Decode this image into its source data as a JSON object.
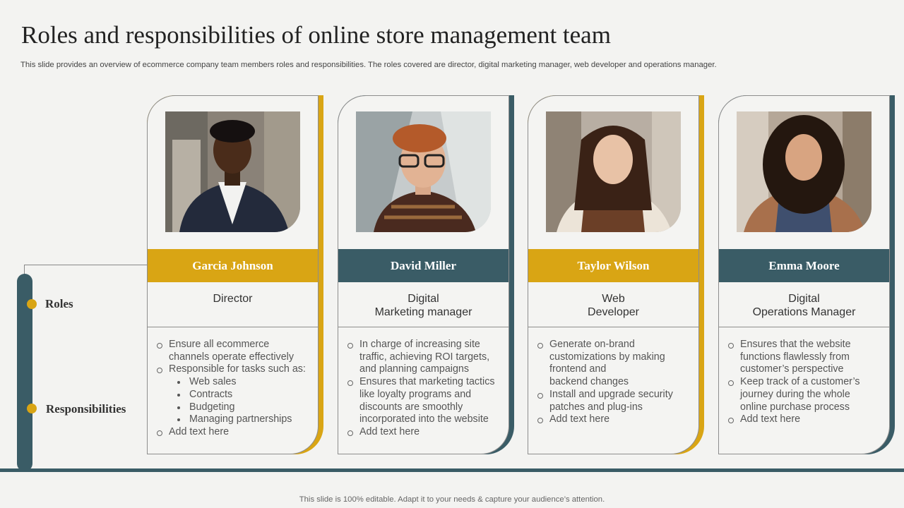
{
  "title": "Roles and responsibilities of online store management team",
  "subtitle": "This slide provides an overview of ecommerce company team members roles and responsibilities. The roles covered are director, digital marketing manager, web developer and operations manager.",
  "rail": {
    "roles_label": "Roles",
    "responsibilities_label": "Responsibilities"
  },
  "colors": {
    "gold": "#d9a514",
    "teal": "#3a5c66"
  },
  "cards": [
    {
      "name": "Garcia Johnson",
      "role": "Director",
      "accent": "gold",
      "photo": "portrait-man-suit",
      "responsibilities": [
        {
          "text": "Ensure all ecommerce",
          "level": 1
        },
        {
          "text": "channels operate effectively",
          "level": 0
        },
        {
          "text": "Responsible for tasks such as:",
          "level": 1
        },
        {
          "text": "Web sales",
          "level": 2
        },
        {
          "text": "Contracts",
          "level": 2
        },
        {
          "text": "Budgeting",
          "level": 2
        },
        {
          "text": "Managing partnerships",
          "level": 2
        },
        {
          "text": "Add text here",
          "level": 1
        }
      ]
    },
    {
      "name": "David Miller",
      "role": "Digital\nMarketing manager",
      "accent": "teal",
      "photo": "portrait-young-man-glasses",
      "responsibilities": [
        {
          "text": "In charge of increasing site",
          "level": 1
        },
        {
          "text": "traffic, achieving ROI targets,",
          "level": 0
        },
        {
          "text": "and planning campaigns",
          "level": 0
        },
        {
          "text": "Ensures that marketing tactics",
          "level": 1
        },
        {
          "text": "like loyalty programs and",
          "level": 0
        },
        {
          "text": "discounts are smoothly",
          "level": 0
        },
        {
          "text": "incorporated into the website",
          "level": 0
        },
        {
          "text": "Add text here",
          "level": 1
        }
      ]
    },
    {
      "name": "Taylor Wilson",
      "role": "Web\nDeveloper",
      "accent": "gold",
      "photo": "portrait-woman-scarf",
      "responsibilities": [
        {
          "text": "Generate on-brand",
          "level": 1
        },
        {
          "text": "customizations by making",
          "level": 0
        },
        {
          "text": "frontend and",
          "level": 0
        },
        {
          "text": "backend changes",
          "level": 0
        },
        {
          "text": "Install and upgrade security",
          "level": 1
        },
        {
          "text": "patches and plug-ins",
          "level": 0
        },
        {
          "text": "Add text here",
          "level": 1
        }
      ]
    },
    {
      "name": "Emma Moore",
      "role": "Digital\nOperations Manager",
      "accent": "teal",
      "photo": "portrait-woman-curly-hair",
      "responsibilities": [
        {
          "text": "Ensures that the website",
          "level": 1
        },
        {
          "text": "functions flawlessly from",
          "level": 0
        },
        {
          "text": "customer’s perspective",
          "level": 0
        },
        {
          "text": "Keep track of a customer’s",
          "level": 1
        },
        {
          "text": "journey during the whole",
          "level": 0
        },
        {
          "text": "online purchase process",
          "level": 0
        },
        {
          "text": "Add text here",
          "level": 1
        }
      ]
    }
  ],
  "footer": "This slide is 100% editable. Adapt it to your needs & capture your audience’s attention."
}
